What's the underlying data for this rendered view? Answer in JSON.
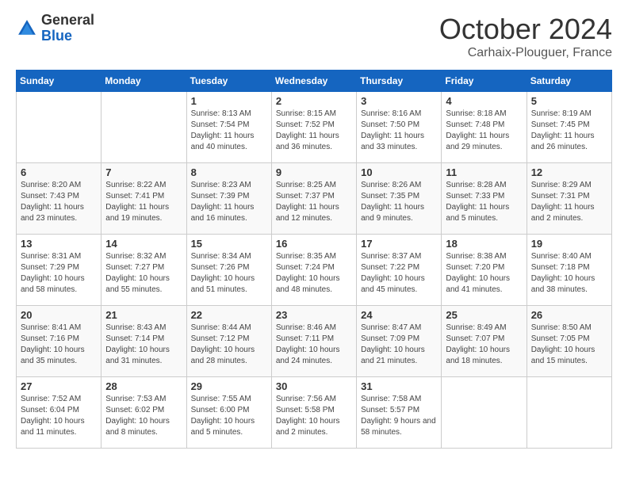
{
  "header": {
    "logo_general": "General",
    "logo_blue": "Blue",
    "month_title": "October 2024",
    "location": "Carhaix-Plouguer, France"
  },
  "days_of_week": [
    "Sunday",
    "Monday",
    "Tuesday",
    "Wednesday",
    "Thursday",
    "Friday",
    "Saturday"
  ],
  "weeks": [
    [
      {
        "day": "",
        "sunrise": "",
        "sunset": "",
        "daylight": ""
      },
      {
        "day": "",
        "sunrise": "",
        "sunset": "",
        "daylight": ""
      },
      {
        "day": "1",
        "sunrise": "Sunrise: 8:13 AM",
        "sunset": "Sunset: 7:54 PM",
        "daylight": "Daylight: 11 hours and 40 minutes."
      },
      {
        "day": "2",
        "sunrise": "Sunrise: 8:15 AM",
        "sunset": "Sunset: 7:52 PM",
        "daylight": "Daylight: 11 hours and 36 minutes."
      },
      {
        "day": "3",
        "sunrise": "Sunrise: 8:16 AM",
        "sunset": "Sunset: 7:50 PM",
        "daylight": "Daylight: 11 hours and 33 minutes."
      },
      {
        "day": "4",
        "sunrise": "Sunrise: 8:18 AM",
        "sunset": "Sunset: 7:48 PM",
        "daylight": "Daylight: 11 hours and 29 minutes."
      },
      {
        "day": "5",
        "sunrise": "Sunrise: 8:19 AM",
        "sunset": "Sunset: 7:45 PM",
        "daylight": "Daylight: 11 hours and 26 minutes."
      }
    ],
    [
      {
        "day": "6",
        "sunrise": "Sunrise: 8:20 AM",
        "sunset": "Sunset: 7:43 PM",
        "daylight": "Daylight: 11 hours and 23 minutes."
      },
      {
        "day": "7",
        "sunrise": "Sunrise: 8:22 AM",
        "sunset": "Sunset: 7:41 PM",
        "daylight": "Daylight: 11 hours and 19 minutes."
      },
      {
        "day": "8",
        "sunrise": "Sunrise: 8:23 AM",
        "sunset": "Sunset: 7:39 PM",
        "daylight": "Daylight: 11 hours and 16 minutes."
      },
      {
        "day": "9",
        "sunrise": "Sunrise: 8:25 AM",
        "sunset": "Sunset: 7:37 PM",
        "daylight": "Daylight: 11 hours and 12 minutes."
      },
      {
        "day": "10",
        "sunrise": "Sunrise: 8:26 AM",
        "sunset": "Sunset: 7:35 PM",
        "daylight": "Daylight: 11 hours and 9 minutes."
      },
      {
        "day": "11",
        "sunrise": "Sunrise: 8:28 AM",
        "sunset": "Sunset: 7:33 PM",
        "daylight": "Daylight: 11 hours and 5 minutes."
      },
      {
        "day": "12",
        "sunrise": "Sunrise: 8:29 AM",
        "sunset": "Sunset: 7:31 PM",
        "daylight": "Daylight: 11 hours and 2 minutes."
      }
    ],
    [
      {
        "day": "13",
        "sunrise": "Sunrise: 8:31 AM",
        "sunset": "Sunset: 7:29 PM",
        "daylight": "Daylight: 10 hours and 58 minutes."
      },
      {
        "day": "14",
        "sunrise": "Sunrise: 8:32 AM",
        "sunset": "Sunset: 7:27 PM",
        "daylight": "Daylight: 10 hours and 55 minutes."
      },
      {
        "day": "15",
        "sunrise": "Sunrise: 8:34 AM",
        "sunset": "Sunset: 7:26 PM",
        "daylight": "Daylight: 10 hours and 51 minutes."
      },
      {
        "day": "16",
        "sunrise": "Sunrise: 8:35 AM",
        "sunset": "Sunset: 7:24 PM",
        "daylight": "Daylight: 10 hours and 48 minutes."
      },
      {
        "day": "17",
        "sunrise": "Sunrise: 8:37 AM",
        "sunset": "Sunset: 7:22 PM",
        "daylight": "Daylight: 10 hours and 45 minutes."
      },
      {
        "day": "18",
        "sunrise": "Sunrise: 8:38 AM",
        "sunset": "Sunset: 7:20 PM",
        "daylight": "Daylight: 10 hours and 41 minutes."
      },
      {
        "day": "19",
        "sunrise": "Sunrise: 8:40 AM",
        "sunset": "Sunset: 7:18 PM",
        "daylight": "Daylight: 10 hours and 38 minutes."
      }
    ],
    [
      {
        "day": "20",
        "sunrise": "Sunrise: 8:41 AM",
        "sunset": "Sunset: 7:16 PM",
        "daylight": "Daylight: 10 hours and 35 minutes."
      },
      {
        "day": "21",
        "sunrise": "Sunrise: 8:43 AM",
        "sunset": "Sunset: 7:14 PM",
        "daylight": "Daylight: 10 hours and 31 minutes."
      },
      {
        "day": "22",
        "sunrise": "Sunrise: 8:44 AM",
        "sunset": "Sunset: 7:12 PM",
        "daylight": "Daylight: 10 hours and 28 minutes."
      },
      {
        "day": "23",
        "sunrise": "Sunrise: 8:46 AM",
        "sunset": "Sunset: 7:11 PM",
        "daylight": "Daylight: 10 hours and 24 minutes."
      },
      {
        "day": "24",
        "sunrise": "Sunrise: 8:47 AM",
        "sunset": "Sunset: 7:09 PM",
        "daylight": "Daylight: 10 hours and 21 minutes."
      },
      {
        "day": "25",
        "sunrise": "Sunrise: 8:49 AM",
        "sunset": "Sunset: 7:07 PM",
        "daylight": "Daylight: 10 hours and 18 minutes."
      },
      {
        "day": "26",
        "sunrise": "Sunrise: 8:50 AM",
        "sunset": "Sunset: 7:05 PM",
        "daylight": "Daylight: 10 hours and 15 minutes."
      }
    ],
    [
      {
        "day": "27",
        "sunrise": "Sunrise: 7:52 AM",
        "sunset": "Sunset: 6:04 PM",
        "daylight": "Daylight: 10 hours and 11 minutes."
      },
      {
        "day": "28",
        "sunrise": "Sunrise: 7:53 AM",
        "sunset": "Sunset: 6:02 PM",
        "daylight": "Daylight: 10 hours and 8 minutes."
      },
      {
        "day": "29",
        "sunrise": "Sunrise: 7:55 AM",
        "sunset": "Sunset: 6:00 PM",
        "daylight": "Daylight: 10 hours and 5 minutes."
      },
      {
        "day": "30",
        "sunrise": "Sunrise: 7:56 AM",
        "sunset": "Sunset: 5:58 PM",
        "daylight": "Daylight: 10 hours and 2 minutes."
      },
      {
        "day": "31",
        "sunrise": "Sunrise: 7:58 AM",
        "sunset": "Sunset: 5:57 PM",
        "daylight": "Daylight: 9 hours and 58 minutes."
      },
      {
        "day": "",
        "sunrise": "",
        "sunset": "",
        "daylight": ""
      },
      {
        "day": "",
        "sunrise": "",
        "sunset": "",
        "daylight": ""
      }
    ]
  ]
}
